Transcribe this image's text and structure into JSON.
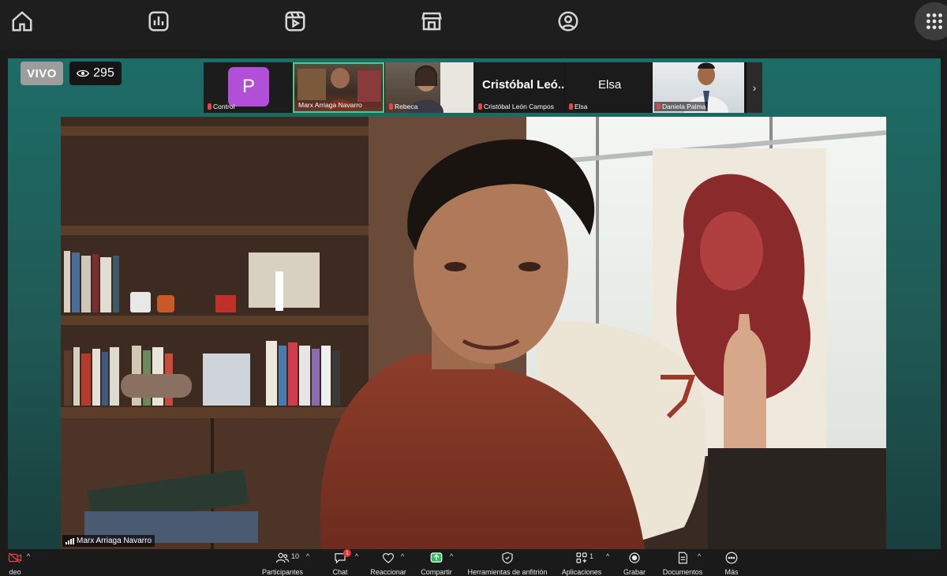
{
  "top_nav": {
    "icons": [
      "home-icon",
      "stats-icon",
      "video-reel-icon",
      "store-icon",
      "profile-icon",
      "apps-grid-icon"
    ]
  },
  "live": {
    "badge": "VIVO",
    "viewer_count": "295"
  },
  "participants_strip": [
    {
      "name": "Control",
      "avatar_letter": "P",
      "avatar_color": "#b24fd8"
    },
    {
      "name": "Marx Arriaga Navarro",
      "active": true
    },
    {
      "name": "Rebeca"
    },
    {
      "name": "Cristóbal León Campos",
      "display_title": "Cristóbal Leó..."
    },
    {
      "name": "Elsa",
      "display_title": "Elsa"
    },
    {
      "name": "Daniela Palma"
    }
  ],
  "main_speaker": {
    "name": "Marx Arriaga Navarro"
  },
  "toolbar": {
    "left_cut_label": "deo",
    "participants": {
      "label": "Participantes",
      "count": "10"
    },
    "chat": {
      "label": "Chat",
      "badge": "1"
    },
    "react": {
      "label": "Reaccionar"
    },
    "share": {
      "label": "Compartir"
    },
    "host_tools": {
      "label": "Herramientas de anfitrión"
    },
    "apps": {
      "label": "Aplicaciones",
      "count": "1"
    },
    "record": {
      "label": "Grabar"
    },
    "docs": {
      "label": "Documentos"
    },
    "more": {
      "label": "Más"
    }
  },
  "colors": {
    "stage_teal": "#1f5a57",
    "active_border": "#3fd18b",
    "muted_red": "#e04848",
    "share_green": "#2fbf5a"
  }
}
